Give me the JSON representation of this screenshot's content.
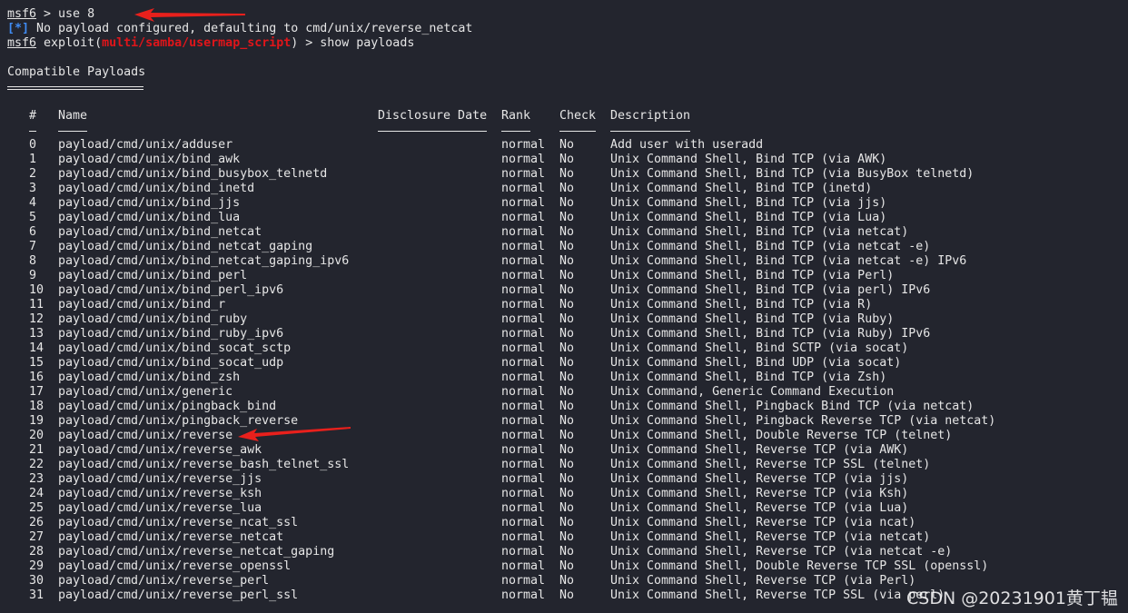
{
  "terminal": {
    "line1": {
      "prompt": "msf6",
      "command": " > use 8"
    },
    "line2": {
      "marker": "[*]",
      "text": " No payload configured, defaulting to cmd/unix/reverse_netcat"
    },
    "line3": {
      "prompt": "msf6",
      "pre": " exploit(",
      "module": "multi/samba/usermap_script",
      "post": ") > show payloads"
    },
    "section_title": "Compatible Payloads",
    "columns": [
      "#",
      "Name",
      "Disclosure Date",
      "Rank",
      "Check",
      "Description"
    ],
    "rows": [
      [
        "0",
        "payload/cmd/unix/adduser",
        "",
        "normal",
        "No",
        "Add user with useradd"
      ],
      [
        "1",
        "payload/cmd/unix/bind_awk",
        "",
        "normal",
        "No",
        "Unix Command Shell, Bind TCP (via AWK)"
      ],
      [
        "2",
        "payload/cmd/unix/bind_busybox_telnetd",
        "",
        "normal",
        "No",
        "Unix Command Shell, Bind TCP (via BusyBox telnetd)"
      ],
      [
        "3",
        "payload/cmd/unix/bind_inetd",
        "",
        "normal",
        "No",
        "Unix Command Shell, Bind TCP (inetd)"
      ],
      [
        "4",
        "payload/cmd/unix/bind_jjs",
        "",
        "normal",
        "No",
        "Unix Command Shell, Bind TCP (via jjs)"
      ],
      [
        "5",
        "payload/cmd/unix/bind_lua",
        "",
        "normal",
        "No",
        "Unix Command Shell, Bind TCP (via Lua)"
      ],
      [
        "6",
        "payload/cmd/unix/bind_netcat",
        "",
        "normal",
        "No",
        "Unix Command Shell, Bind TCP (via netcat)"
      ],
      [
        "7",
        "payload/cmd/unix/bind_netcat_gaping",
        "",
        "normal",
        "No",
        "Unix Command Shell, Bind TCP (via netcat -e)"
      ],
      [
        "8",
        "payload/cmd/unix/bind_netcat_gaping_ipv6",
        "",
        "normal",
        "No",
        "Unix Command Shell, Bind TCP (via netcat -e) IPv6"
      ],
      [
        "9",
        "payload/cmd/unix/bind_perl",
        "",
        "normal",
        "No",
        "Unix Command Shell, Bind TCP (via Perl)"
      ],
      [
        "10",
        "payload/cmd/unix/bind_perl_ipv6",
        "",
        "normal",
        "No",
        "Unix Command Shell, Bind TCP (via perl) IPv6"
      ],
      [
        "11",
        "payload/cmd/unix/bind_r",
        "",
        "normal",
        "No",
        "Unix Command Shell, Bind TCP (via R)"
      ],
      [
        "12",
        "payload/cmd/unix/bind_ruby",
        "",
        "normal",
        "No",
        "Unix Command Shell, Bind TCP (via Ruby)"
      ],
      [
        "13",
        "payload/cmd/unix/bind_ruby_ipv6",
        "",
        "normal",
        "No",
        "Unix Command Shell, Bind TCP (via Ruby) IPv6"
      ],
      [
        "14",
        "payload/cmd/unix/bind_socat_sctp",
        "",
        "normal",
        "No",
        "Unix Command Shell, Bind SCTP (via socat)"
      ],
      [
        "15",
        "payload/cmd/unix/bind_socat_udp",
        "",
        "normal",
        "No",
        "Unix Command Shell, Bind UDP (via socat)"
      ],
      [
        "16",
        "payload/cmd/unix/bind_zsh",
        "",
        "normal",
        "No",
        "Unix Command Shell, Bind TCP (via Zsh)"
      ],
      [
        "17",
        "payload/cmd/unix/generic",
        "",
        "normal",
        "No",
        "Unix Command, Generic Command Execution"
      ],
      [
        "18",
        "payload/cmd/unix/pingback_bind",
        "",
        "normal",
        "No",
        "Unix Command Shell, Pingback Bind TCP (via netcat)"
      ],
      [
        "19",
        "payload/cmd/unix/pingback_reverse",
        "",
        "normal",
        "No",
        "Unix Command Shell, Pingback Reverse TCP (via netcat)"
      ],
      [
        "20",
        "payload/cmd/unix/reverse",
        "",
        "normal",
        "No",
        "Unix Command Shell, Double Reverse TCP (telnet)"
      ],
      [
        "21",
        "payload/cmd/unix/reverse_awk",
        "",
        "normal",
        "No",
        "Unix Command Shell, Reverse TCP (via AWK)"
      ],
      [
        "22",
        "payload/cmd/unix/reverse_bash_telnet_ssl",
        "",
        "normal",
        "No",
        "Unix Command Shell, Reverse TCP SSL (telnet)"
      ],
      [
        "23",
        "payload/cmd/unix/reverse_jjs",
        "",
        "normal",
        "No",
        "Unix Command Shell, Reverse TCP (via jjs)"
      ],
      [
        "24",
        "payload/cmd/unix/reverse_ksh",
        "",
        "normal",
        "No",
        "Unix Command Shell, Reverse TCP (via Ksh)"
      ],
      [
        "25",
        "payload/cmd/unix/reverse_lua",
        "",
        "normal",
        "No",
        "Unix Command Shell, Reverse TCP (via Lua)"
      ],
      [
        "26",
        "payload/cmd/unix/reverse_ncat_ssl",
        "",
        "normal",
        "No",
        "Unix Command Shell, Reverse TCP (via ncat)"
      ],
      [
        "27",
        "payload/cmd/unix/reverse_netcat",
        "",
        "normal",
        "No",
        "Unix Command Shell, Reverse TCP (via netcat)"
      ],
      [
        "28",
        "payload/cmd/unix/reverse_netcat_gaping",
        "",
        "normal",
        "No",
        "Unix Command Shell, Reverse TCP (via netcat -e)"
      ],
      [
        "29",
        "payload/cmd/unix/reverse_openssl",
        "",
        "normal",
        "No",
        "Unix Command Shell, Double Reverse TCP SSL (openssl)"
      ],
      [
        "30",
        "payload/cmd/unix/reverse_perl",
        "",
        "normal",
        "No",
        "Unix Command Shell, Reverse TCP (via Perl)"
      ],
      [
        "31",
        "payload/cmd/unix/reverse_perl_ssl",
        "",
        "normal",
        "No",
        "Unix Command Shell, Reverse TCP SSL (via perl)"
      ]
    ]
  },
  "watermark": "CSDN @20231901黄丁韫",
  "colors": {
    "background": "#23252e",
    "text": "#e6e6e6",
    "module": "#e0151a",
    "marker": "#3f8cf5",
    "arrow": "#e8201c"
  }
}
